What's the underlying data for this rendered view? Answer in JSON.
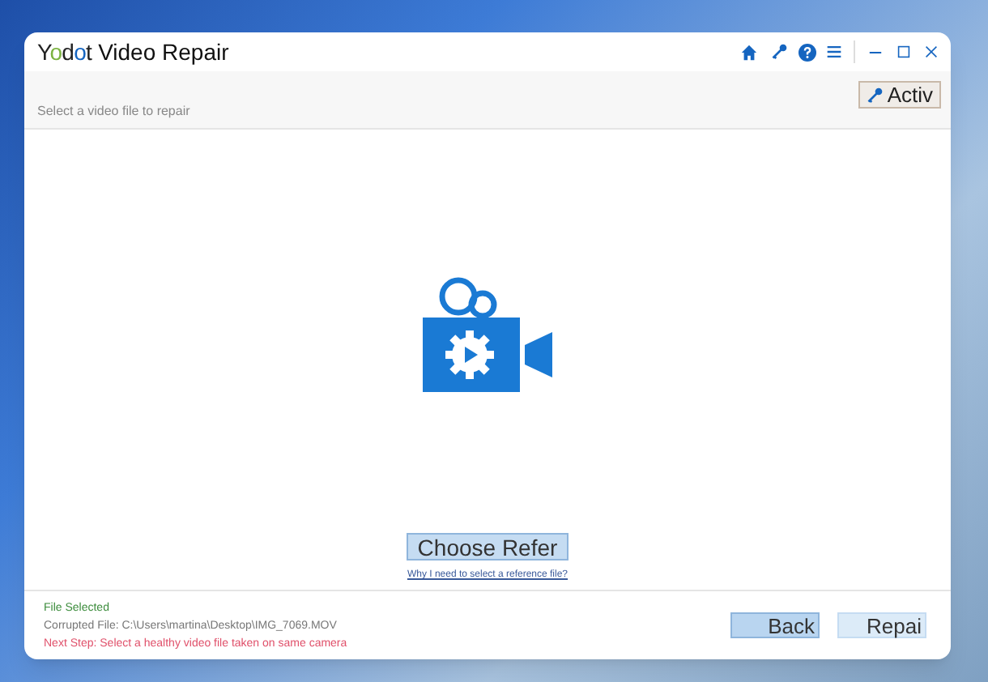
{
  "window": {
    "logo": "Yodot",
    "title": "Video Repair"
  },
  "header": {
    "prompt": "Select a video file to repair",
    "activate_button": "Activ"
  },
  "main": {
    "choose_button": "Choose Refer",
    "help_link": "Why I need to select a reference file?"
  },
  "status": {
    "title": "File Selected",
    "file": "Corrupted File: C:\\Users\\martina\\Desktop\\IMG_7069.MOV",
    "next_step": "Next Step: Select a healthy video file taken on same camera"
  },
  "buttons": [
    {
      "label": "Back",
      "selected": true
    },
    {
      "label": "Repai",
      "selected": false
    }
  ]
}
